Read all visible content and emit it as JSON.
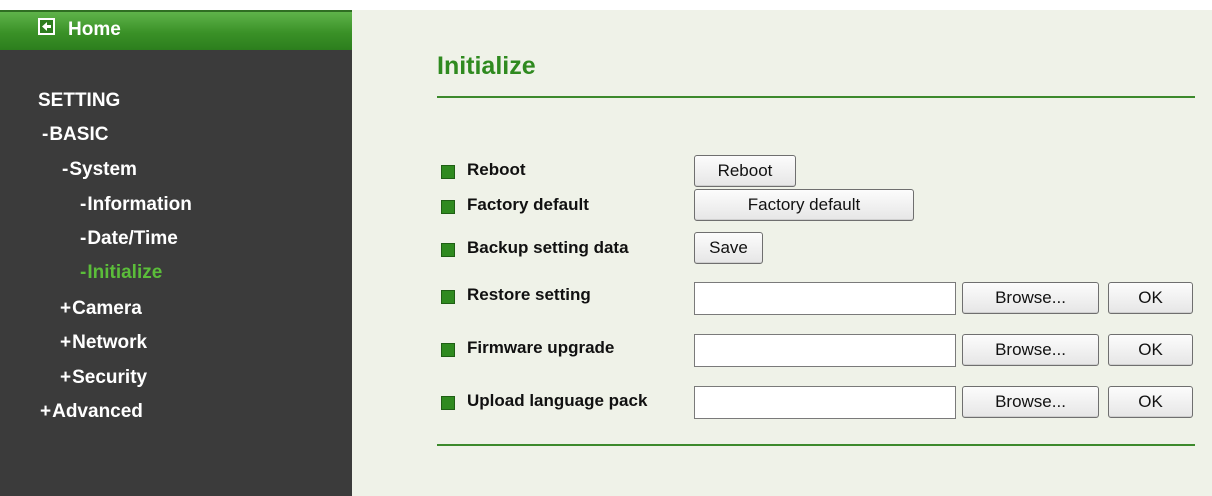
{
  "sidebar": {
    "home_label": "Home",
    "section_title": "SETTING",
    "items": [
      {
        "prefix": "-",
        "label": "BASIC"
      },
      {
        "prefix": "-",
        "label": "System"
      },
      {
        "prefix": "-",
        "label": "Information"
      },
      {
        "prefix": "-",
        "label": "Date/Time"
      },
      {
        "prefix": "-",
        "label": "Initialize"
      },
      {
        "prefix": "+",
        "label": "Camera"
      },
      {
        "prefix": "+",
        "label": "Network"
      },
      {
        "prefix": "+",
        "label": "Security"
      },
      {
        "prefix": "+",
        "label": "Advanced"
      }
    ],
    "active_item": "Initialize"
  },
  "main": {
    "title": "Initialize",
    "rows": [
      {
        "label": "Reboot",
        "button": "Reboot"
      },
      {
        "label": "Factory default",
        "button": "Factory default"
      },
      {
        "label": "Backup setting data",
        "button": "Save"
      },
      {
        "label": "Restore setting",
        "file_value": "",
        "browse": "Browse...",
        "ok": "OK"
      },
      {
        "label": "Firmware upgrade",
        "file_value": "",
        "browse": "Browse...",
        "ok": "OK"
      },
      {
        "label": "Upload language pack",
        "file_value": "",
        "browse": "Browse...",
        "ok": "OK"
      }
    ]
  },
  "colors": {
    "accent_green": "#2f8a1f",
    "active_nav": "#5bbd3a",
    "sidebar_bg": "#3b3b3b",
    "content_bg": "#eff2e8"
  },
  "icons": {
    "home": "back-arrow-icon",
    "row_bullet": "green-square-bullet-icon"
  }
}
